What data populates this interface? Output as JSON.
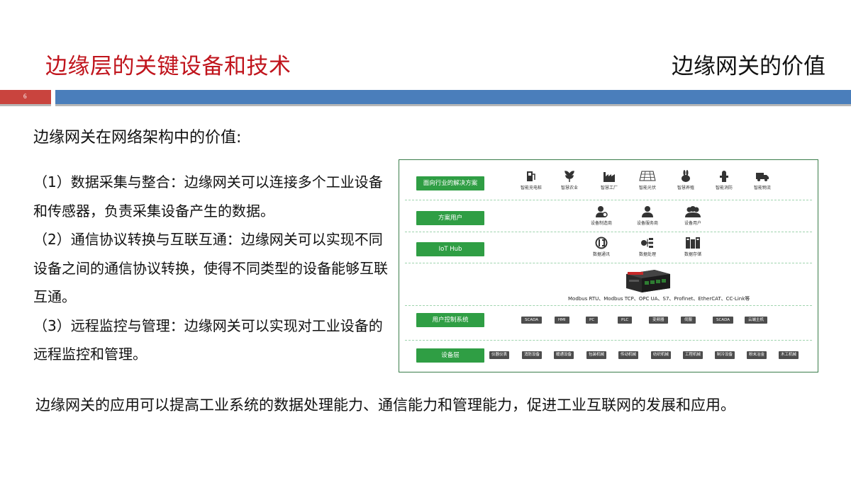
{
  "header": {
    "title": "边缘层的关键设备和技术",
    "section": "边缘网关的价值",
    "slide_number": "6"
  },
  "body": {
    "subtitle": "边缘网关在网络架构中的价值:",
    "points": [
      "（1）数据采集与整合：边缘网关可以连接多个工业设备和传感器，负责采集设备产生的数据。",
      "（2）通信协议转换与互联互通：边缘网关可以实现不同设备之间的通信协议转换，使得不同类型的设备能够互联互通。",
      "（3）远程监控与管理：边缘网关可以实现对工业设备的远程监控和管理。"
    ],
    "conclusion": "边缘网关的应用可以提高工业系统的数据处理能力、通信能力和管理能力，促进工业互联网的发展和应用。"
  },
  "diagram": {
    "rows": {
      "industry": "面向行业的解决方案",
      "users": "方案用户",
      "iot": "IoT Hub",
      "control": "用户控制系统",
      "device": "设备层"
    },
    "industry_items": [
      "智能充电桩",
      "智慧农业",
      "智慧工厂",
      "智能光伏",
      "智慧养殖",
      "智能消防",
      "智能物流"
    ],
    "user_items": [
      "设备制造商",
      "设备服务商",
      "设备用户"
    ],
    "iot_items": [
      "数据通讯",
      "数据处理",
      "数据存储"
    ],
    "protocols": "Modbus RTU、Modbus TCP、OPC UA、S7、Profinet、EtherCAT、CC-Link等",
    "control_items": [
      "SCADA",
      "HMI",
      "PC",
      "PLC",
      "变频器",
      "伺服",
      "SCADA",
      "云端主机"
    ],
    "device_items": [
      "仪器仪表",
      "消防设备",
      "暖通设备",
      "包装机械",
      "传动机械",
      "纺织机械",
      "工程机械",
      "制冷设备",
      "粉末冶金",
      "木工机械"
    ],
    "colors": {
      "accent_green": "#2f9e44",
      "chip": "#4d4d4d"
    }
  }
}
